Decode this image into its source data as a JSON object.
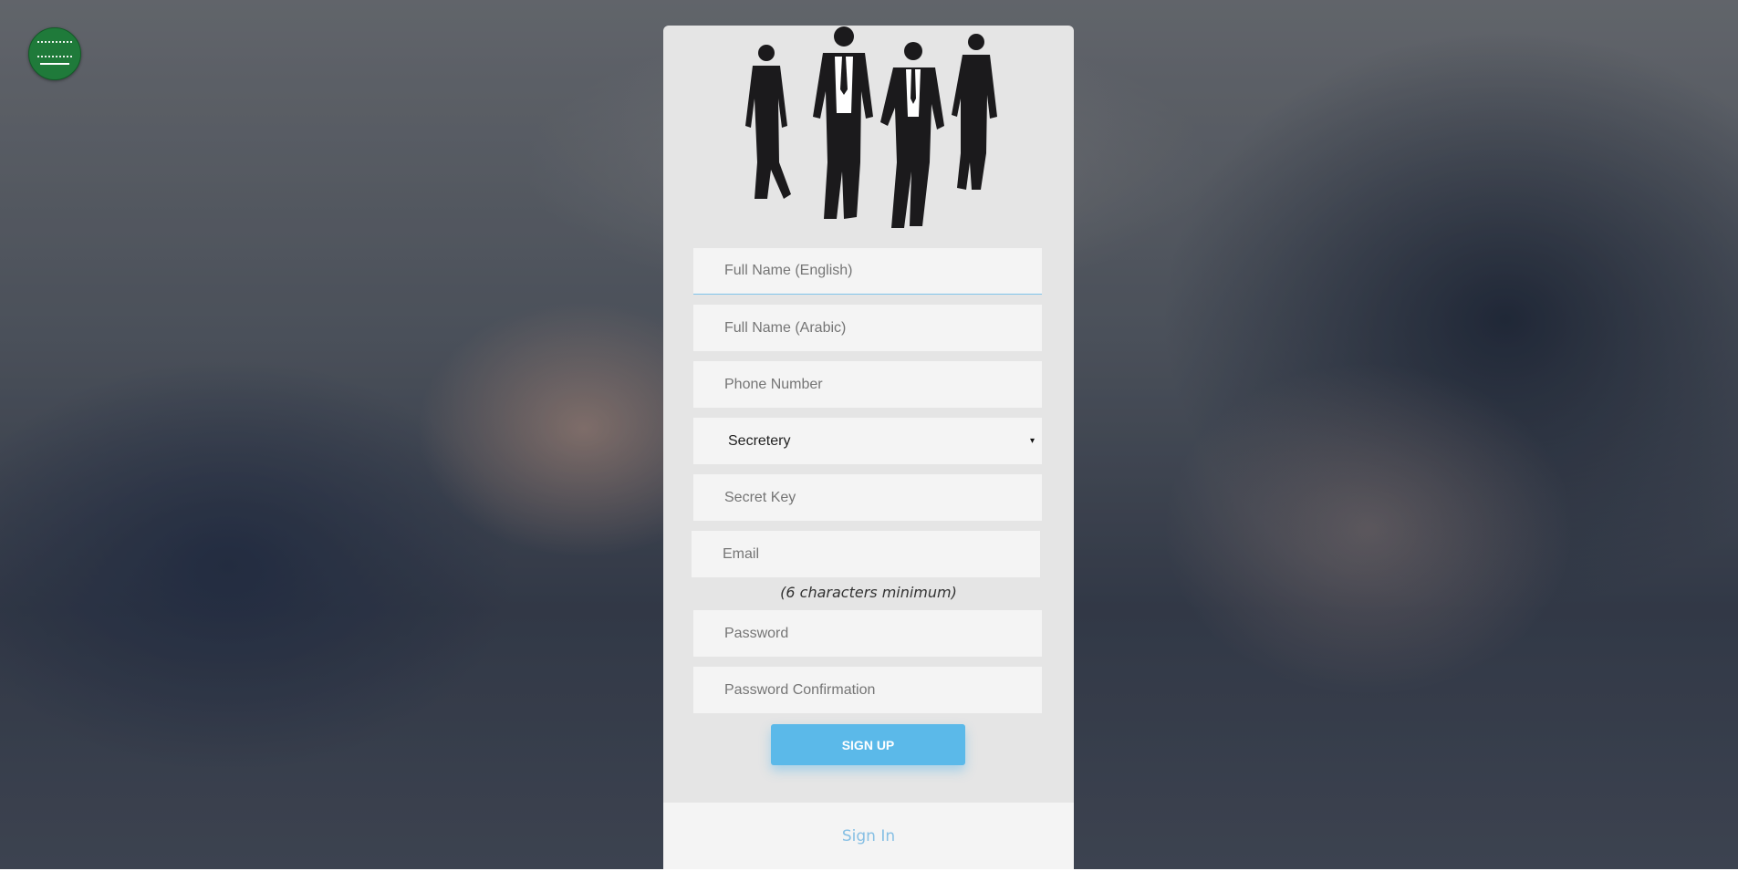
{
  "form": {
    "fields": {
      "full_name_en": {
        "placeholder": "Full Name (English)"
      },
      "full_name_ar": {
        "placeholder": "Full Name (Arabic)"
      },
      "phone": {
        "placeholder": "Phone Number"
      },
      "role": {
        "selected": "Secretery",
        "arrow": "▾"
      },
      "secret_key": {
        "placeholder": "Secret Key"
      },
      "email": {
        "placeholder": "Email"
      },
      "password": {
        "placeholder": "Password"
      },
      "password_confirm": {
        "placeholder": "Password Confirmation"
      }
    },
    "password_hint": "(6 characters minimum)",
    "submit_label": "SIGN UP"
  },
  "footer": {
    "signin_label": "Sign In"
  },
  "colors": {
    "accent": "#5bb9e9",
    "link": "#86bfe4",
    "card_bg": "#e5e5e5",
    "field_bg": "#f4f4f4",
    "flag_green": "#1f7a3a"
  },
  "icons": {
    "logo": "saudi-flag-icon",
    "hero": "business-people-silhouette"
  }
}
